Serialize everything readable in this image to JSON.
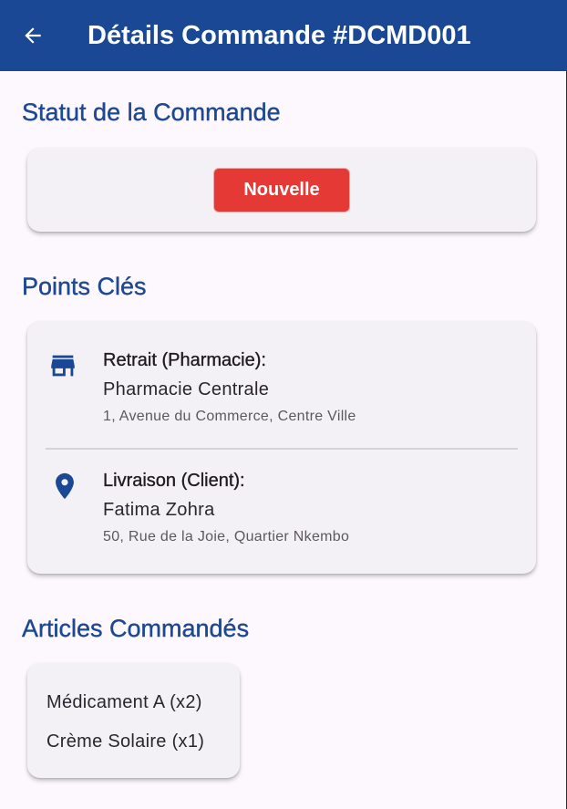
{
  "appbar": {
    "title": "Détails Commande #DCMD001",
    "back_icon": "arrow-back-icon",
    "background": "#1A4894"
  },
  "status_section": {
    "title": "Statut de la Commande",
    "badge_label": "Nouvelle",
    "badge_color": "#E53935"
  },
  "points_section": {
    "title": "Points Clés",
    "pickup": {
      "icon": "store-icon",
      "label": "Retrait (Pharmacie):",
      "name": "Pharmacie Centrale",
      "address": "1, Avenue du Commerce, Centre Ville"
    },
    "delivery": {
      "icon": "location-pin-icon",
      "label": "Livraison (Client):",
      "name": "Fatima Zohra",
      "address": "50, Rue de la Joie, Quartier Nkembo"
    }
  },
  "articles_section": {
    "title": "Articles Commandés",
    "items": [
      "Médicament A (x2)",
      "Crème Solaire (x1)"
    ]
  },
  "colors": {
    "accent": "#1E4892",
    "page_background": "#FDF7FE",
    "card_background": "#F4F1F6"
  }
}
